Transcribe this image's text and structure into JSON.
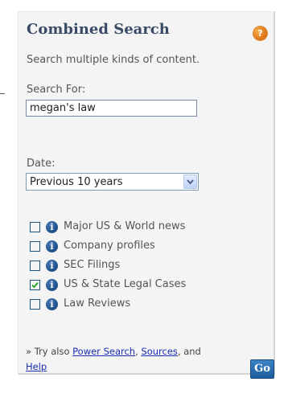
{
  "widget": {
    "title": "Combined Search",
    "help_icon_glyph": "?",
    "description": "Search multiple kinds of content.",
    "search_label": "Search For:",
    "search_value": "megan's law",
    "date_label": "Date:",
    "date_selected": "Previous 10 years"
  },
  "categories": [
    {
      "label": "Major US & World news",
      "checked": false
    },
    {
      "label": "Company profiles",
      "checked": false
    },
    {
      "label": "SEC Filings",
      "checked": false
    },
    {
      "label": "US & State Legal Cases",
      "checked": true
    },
    {
      "label": "Law Reviews",
      "checked": false
    }
  ],
  "footer": {
    "try_prefix": "» Try also ",
    "power_search_link": "Power Search",
    "sep1": ", ",
    "sources_link": "Sources",
    "sep2": ", and",
    "help_link": "Help",
    "go_label": "Go"
  },
  "icons": {
    "info": "i",
    "help": "question-icon",
    "dropdown": "chevron-down-icon"
  },
  "colors": {
    "title": "#3a4a66",
    "link": "#1a2fb3",
    "go_button": "#2a70b0",
    "help_icon": "#e07818",
    "info_icon": "#1e4f8c"
  }
}
